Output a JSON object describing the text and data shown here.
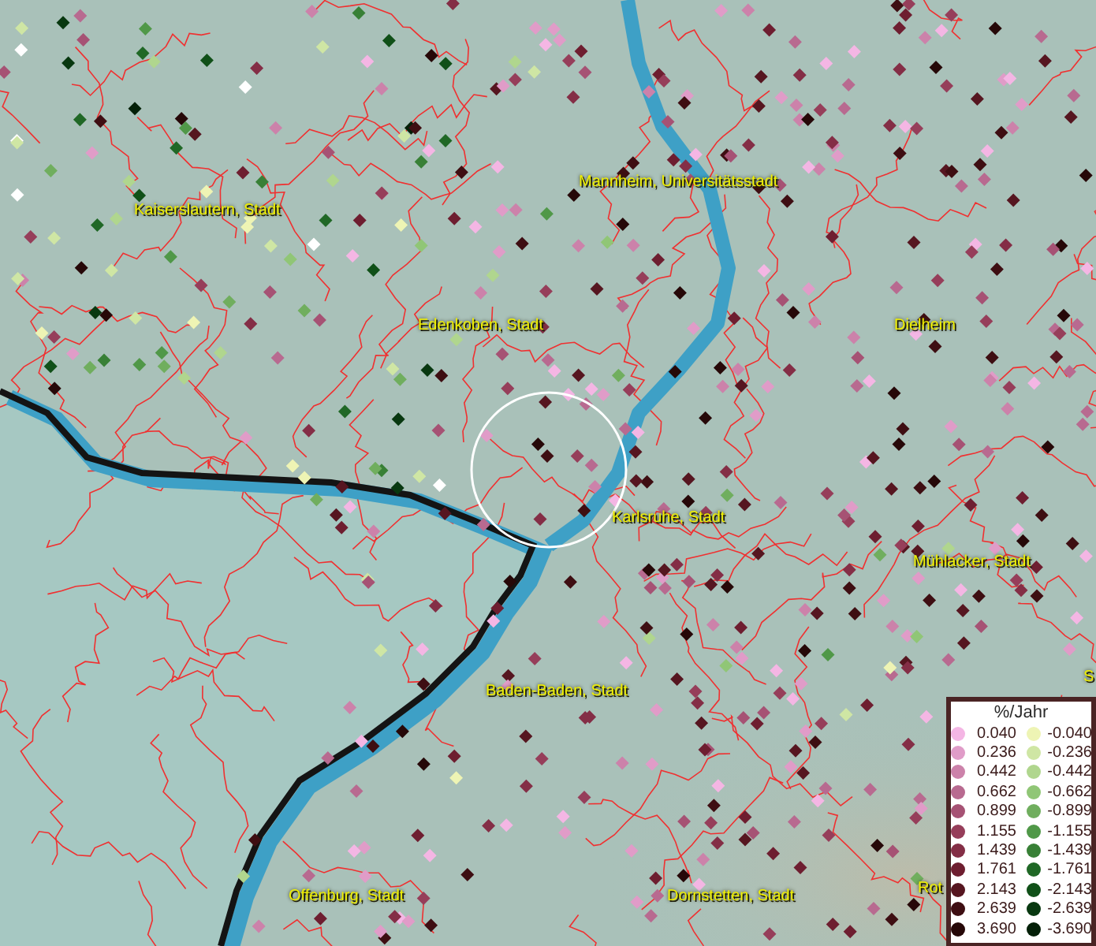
{
  "map": {
    "places": [
      {
        "name": "Kaiserslautern, Stadt"
      },
      {
        "name": "Mannheim, Universitätsstadt"
      },
      {
        "name": "Edenkoben, Stadt"
      },
      {
        "name": "Dielheim"
      },
      {
        "name": "Karlsruhe, Stadt"
      },
      {
        "name": "Mühlacker, Stadt"
      },
      {
        "name": "S"
      },
      {
        "name": "Baden-Baden, Stadt"
      },
      {
        "name": "Offenburg, Stadt"
      },
      {
        "name": "Dornstetten, Stadt"
      },
      {
        "name": "Rot"
      }
    ]
  },
  "legend": {
    "title": "%/Jahr",
    "rows": [
      {
        "up": {
          "label": "0.040",
          "color": "#f4b6e4"
        },
        "down": {
          "label": "-0.040",
          "color": "#eef4b4"
        }
      },
      {
        "up": {
          "label": "0.236",
          "color": "#e09cc8"
        },
        "down": {
          "label": "-0.236",
          "color": "#cfe6a4"
        }
      },
      {
        "up": {
          "label": "0.442",
          "color": "#cc82aa"
        },
        "down": {
          "label": "-0.442",
          "color": "#b0d68e"
        }
      },
      {
        "up": {
          "label": "0.662",
          "color": "#b86a90"
        },
        "down": {
          "label": "-0.662",
          "color": "#90c676"
        }
      },
      {
        "up": {
          "label": "0.899",
          "color": "#a65274"
        },
        "down": {
          "label": "-0.899",
          "color": "#70ae5e"
        }
      },
      {
        "up": {
          "label": "1.155",
          "color": "#963e5a"
        },
        "down": {
          "label": "-1.155",
          "color": "#509848"
        }
      },
      {
        "up": {
          "label": "1.439",
          "color": "#842e46"
        },
        "down": {
          "label": "-1.439",
          "color": "#388036"
        }
      },
      {
        "up": {
          "label": "1.761",
          "color": "#6e1e30"
        },
        "down": {
          "label": "-1.761",
          "color": "#206826"
        }
      },
      {
        "up": {
          "label": "2.143",
          "color": "#561620"
        },
        "down": {
          "label": "-2.143",
          "color": "#105018"
        }
      },
      {
        "up": {
          "label": "2.639",
          "color": "#3e0e12"
        },
        "down": {
          "label": "-2.639",
          "color": "#083810"
        }
      },
      {
        "up": {
          "label": "3.690",
          "color": "#260808"
        },
        "down": {
          "label": "-3.690",
          "color": "#042008"
        }
      }
    ]
  }
}
